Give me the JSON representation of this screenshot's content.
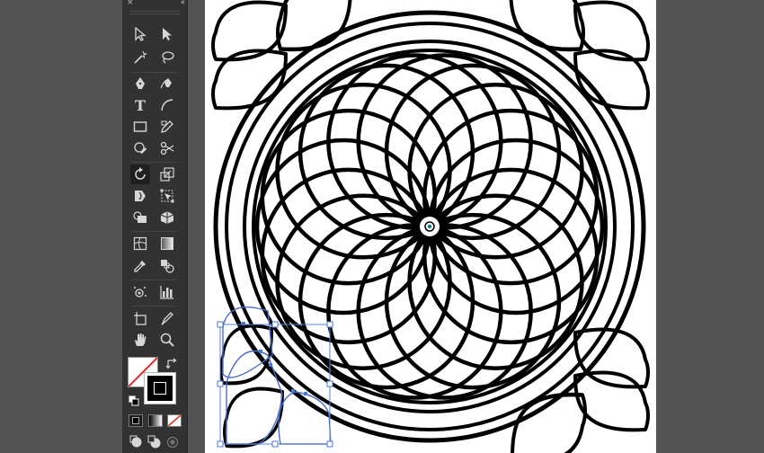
{
  "window": {
    "panel_close_glyph": "×",
    "panel_collapse_glyph": "‹‹"
  },
  "toolbar": {
    "tools": [
      {
        "name": "selection-tool-icon"
      },
      {
        "name": "direct-selection-tool-icon"
      },
      {
        "name": "magic-wand-tool-icon"
      },
      {
        "name": "lasso-tool-icon"
      },
      {
        "name": "pen-tool-icon"
      },
      {
        "name": "curvature-tool-icon"
      },
      {
        "name": "type-tool-icon",
        "glyph": "T"
      },
      {
        "name": "arc-tool-icon"
      },
      {
        "name": "rectangle-tool-icon"
      },
      {
        "name": "pencil-tool-icon"
      },
      {
        "name": "shaper-tool-icon"
      },
      {
        "name": "scissors-tool-icon"
      },
      {
        "name": "rotate-tool-icon",
        "active": true
      },
      {
        "name": "scale-tool-icon"
      },
      {
        "name": "warp-tool-icon"
      },
      {
        "name": "free-transform-tool-icon"
      },
      {
        "name": "shape-builder-tool-icon"
      },
      {
        "name": "perspective-grid-tool-icon"
      },
      {
        "name": "mesh-tool-icon"
      },
      {
        "name": "gradient-tool-icon"
      },
      {
        "name": "eyedropper-tool-icon"
      },
      {
        "name": "blend-tool-icon"
      },
      {
        "name": "symbol-sprayer-tool-icon"
      },
      {
        "name": "column-graph-tool-icon"
      },
      {
        "name": "artboard-tool-icon"
      },
      {
        "name": "slice-tool-icon"
      },
      {
        "name": "hand-tool-icon"
      },
      {
        "name": "zoom-tool-icon"
      }
    ],
    "fill_color": "none",
    "stroke_color": "#000000",
    "modes": [
      "color-mode-icon",
      "gradient-mode-icon",
      "none-mode-icon"
    ],
    "draw_modes": [
      "draw-normal-icon",
      "draw-behind-icon",
      "draw-inside-icon"
    ]
  },
  "colors": {
    "workspace": "#535353",
    "panel": "#323232",
    "icon": "#d6d6d6",
    "selection": "#4a78d6",
    "artboard": "#ffffff",
    "artwork_stroke": "#000000"
  }
}
